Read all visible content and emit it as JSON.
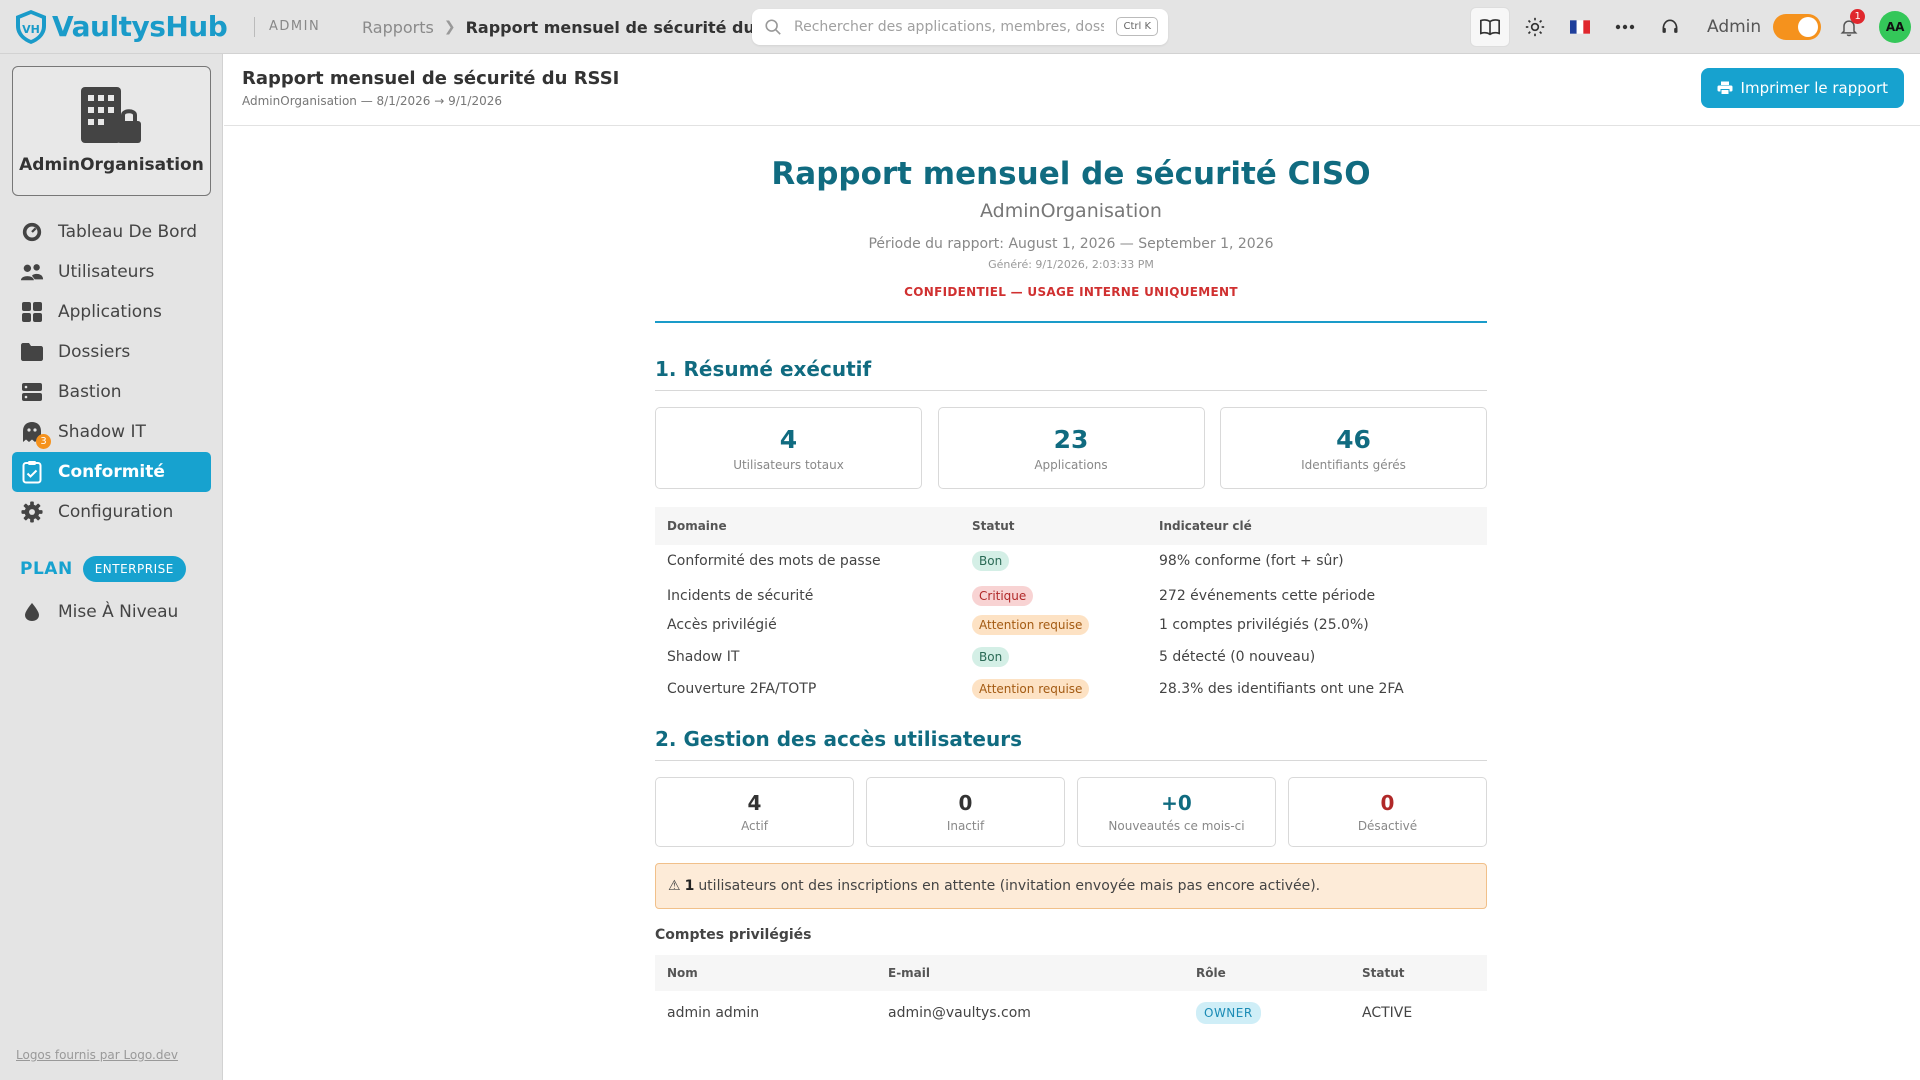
{
  "topbar": {
    "brand": "VaultysHub",
    "admin_tag": "ADMIN",
    "breadcrumb": [
      "Rapports",
      "Rapport mensuel de sécurité du RSSI"
    ],
    "search_placeholder": "Rechercher des applications, membres, dossiers",
    "search_shortcut": "Ctrl K",
    "admin_label": "Admin",
    "notif_count": "1",
    "avatar_initials": "AA"
  },
  "sidebar": {
    "org_name": "AdminOrganisation",
    "items": [
      {
        "label": "Tableau De Bord",
        "icon": "gauge-icon"
      },
      {
        "label": "Utilisateurs",
        "icon": "users-icon"
      },
      {
        "label": "Applications",
        "icon": "grid-icon"
      },
      {
        "label": "Dossiers",
        "icon": "folder-icon"
      },
      {
        "label": "Bastion",
        "icon": "server-icon"
      },
      {
        "label": "Shadow IT",
        "icon": "ghost-icon",
        "badge": "3"
      },
      {
        "label": "Conformité",
        "icon": "clipboard-check-icon",
        "active": true
      },
      {
        "label": "Configuration",
        "icon": "gear-icon"
      }
    ],
    "plan_label": "PLAN",
    "plan_name": "ENTERPRISE",
    "upgrade_label": "Mise À Niveau",
    "footer_link": "Logos fournis par Logo.dev"
  },
  "header": {
    "title": "Rapport mensuel de sécurité du RSSI",
    "subtitle": "AdminOrganisation — 8/1/2026 → 9/1/2026",
    "print_label": "Imprimer le rapport"
  },
  "report": {
    "title": "Rapport mensuel de sécurité CISO",
    "org": "AdminOrganisation",
    "period": "Période du rapport: August 1, 2026 — September 1, 2026",
    "generated": "Généré: 9/1/2026, 2:03:33 PM",
    "confidential": "CONFIDENTIEL — USAGE INTERNE UNIQUEMENT",
    "section1": {
      "title": "1. Résumé exécutif",
      "cards": [
        {
          "value": "4",
          "label": "Utilisateurs totaux"
        },
        {
          "value": "23",
          "label": "Applications"
        },
        {
          "value": "46",
          "label": "Identifiants gérés"
        }
      ],
      "columns": [
        "Domaine",
        "Statut",
        "Indicateur clé"
      ],
      "rows": [
        {
          "domain": "Conformité des mots de passe",
          "status": "Bon",
          "kind": "good",
          "indicator": "98% conforme (fort + sûr)"
        },
        {
          "domain": "Incidents de sécurité",
          "status": "Critique",
          "kind": "crit",
          "indicator": "272 événements cette période"
        },
        {
          "domain": "Accès privilégié",
          "status": "Attention requise",
          "kind": "warn",
          "indicator": "1 comptes privilégiés (25.0%)"
        },
        {
          "domain": "Shadow IT",
          "status": "Bon",
          "kind": "good",
          "indicator": "5 détecté (0 nouveau)"
        },
        {
          "domain": "Couverture 2FA/TOTP",
          "status": "Attention requise",
          "kind": "warn",
          "indicator": "28.3% des identifiants ont une 2FA"
        }
      ]
    },
    "section2": {
      "title": "2. Gestion des accès utilisateurs",
      "cards": [
        {
          "value": "4",
          "label": "Actif",
          "color": "dark"
        },
        {
          "value": "0",
          "label": "Inactif",
          "color": "dark"
        },
        {
          "value": "+0",
          "label": "Nouveautés ce mois-ci",
          "color": "teal"
        },
        {
          "value": "0",
          "label": "Désactivé",
          "color": "red"
        }
      ],
      "warning_icon": "⚠",
      "warning_count": "1",
      "warning_text": "utilisateurs ont des inscriptions en attente (invitation envoyée mais pas encore activée).",
      "privileged_title": "Comptes privilégiés",
      "privileged_columns": [
        "Nom",
        "E-mail",
        "Rôle",
        "Statut"
      ],
      "privileged_rows": [
        {
          "name": "admin admin",
          "email": "admin@vaultys.com",
          "role": "OWNER",
          "status": "ACTIVE"
        }
      ]
    }
  }
}
